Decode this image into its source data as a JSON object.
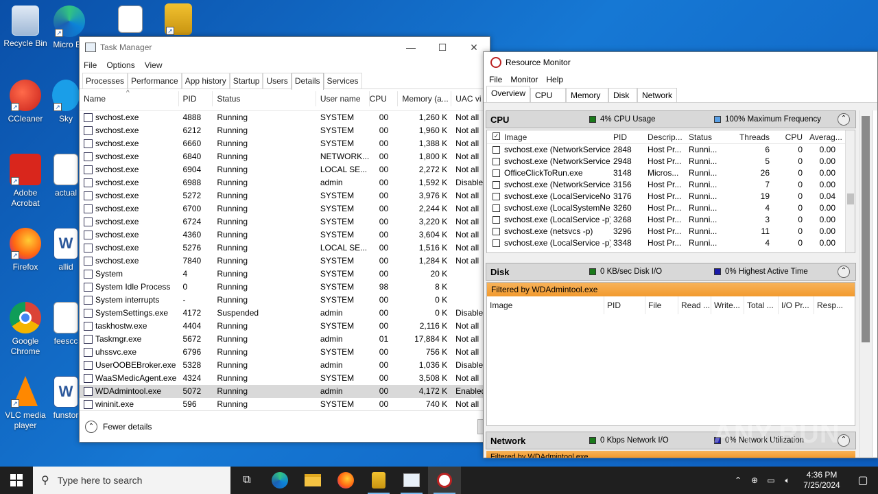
{
  "desktop": {
    "icons": [
      {
        "label": "Recycle Bin"
      },
      {
        "label": "Micro Ed"
      },
      {
        "label": "CCleaner"
      },
      {
        "label": "Sky"
      },
      {
        "label": "Adobe Acrobat"
      },
      {
        "label": "actual"
      },
      {
        "label": "Firefox"
      },
      {
        "label": "allid"
      },
      {
        "label": "Google Chrome"
      },
      {
        "label": "feescc"
      },
      {
        "label": "VLC media player"
      },
      {
        "label": "funstor"
      }
    ]
  },
  "taskmanager": {
    "title": "Task Manager",
    "controls": {
      "minimize": "—",
      "maximize": "☐",
      "close": "✕"
    },
    "menu": [
      "File",
      "Options",
      "View"
    ],
    "tabs": [
      "Processes",
      "Performance",
      "App history",
      "Startup",
      "Users",
      "Details",
      "Services"
    ],
    "active_tab": "Details",
    "columns": [
      "Name",
      "PID",
      "Status",
      "User name",
      "CPU",
      "Memory (a...",
      "UAC vi"
    ],
    "rows": [
      [
        "svchost.exe",
        "4888",
        "Running",
        "SYSTEM",
        "00",
        "1,260 K",
        "Not all"
      ],
      [
        "svchost.exe",
        "6212",
        "Running",
        "SYSTEM",
        "00",
        "1,960 K",
        "Not all"
      ],
      [
        "svchost.exe",
        "6660",
        "Running",
        "SYSTEM",
        "00",
        "1,388 K",
        "Not all"
      ],
      [
        "svchost.exe",
        "6840",
        "Running",
        "NETWORK...",
        "00",
        "1,800 K",
        "Not all"
      ],
      [
        "svchost.exe",
        "6904",
        "Running",
        "LOCAL SE...",
        "00",
        "2,272 K",
        "Not all"
      ],
      [
        "svchost.exe",
        "6988",
        "Running",
        "admin",
        "00",
        "1,592 K",
        "Disable"
      ],
      [
        "svchost.exe",
        "5272",
        "Running",
        "SYSTEM",
        "00",
        "3,976 K",
        "Not all"
      ],
      [
        "svchost.exe",
        "6700",
        "Running",
        "SYSTEM",
        "00",
        "2,244 K",
        "Not all"
      ],
      [
        "svchost.exe",
        "6724",
        "Running",
        "SYSTEM",
        "00",
        "3,220 K",
        "Not all"
      ],
      [
        "svchost.exe",
        "4360",
        "Running",
        "SYSTEM",
        "00",
        "3,604 K",
        "Not all"
      ],
      [
        "svchost.exe",
        "5276",
        "Running",
        "LOCAL SE...",
        "00",
        "1,516 K",
        "Not all"
      ],
      [
        "svchost.exe",
        "7840",
        "Running",
        "SYSTEM",
        "00",
        "1,284 K",
        "Not all"
      ],
      [
        "System",
        "4",
        "Running",
        "SYSTEM",
        "00",
        "20 K",
        ""
      ],
      [
        "System Idle Process",
        "0",
        "Running",
        "SYSTEM",
        "98",
        "8 K",
        ""
      ],
      [
        "System interrupts",
        "-",
        "Running",
        "SYSTEM",
        "00",
        "0 K",
        ""
      ],
      [
        "SystemSettings.exe",
        "4172",
        "Suspended",
        "admin",
        "00",
        "0 K",
        "Disable"
      ],
      [
        "taskhostw.exe",
        "4404",
        "Running",
        "SYSTEM",
        "00",
        "2,116 K",
        "Not all"
      ],
      [
        "Taskmgr.exe",
        "5672",
        "Running",
        "admin",
        "01",
        "17,884 K",
        "Not all"
      ],
      [
        "uhssvc.exe",
        "6796",
        "Running",
        "SYSTEM",
        "00",
        "756 K",
        "Not all"
      ],
      [
        "UserOOBEBroker.exe",
        "5328",
        "Running",
        "admin",
        "00",
        "1,036 K",
        "Disable"
      ],
      [
        "WaaSMedicAgent.exe",
        "4324",
        "Running",
        "SYSTEM",
        "00",
        "3,508 K",
        "Not all"
      ],
      [
        "WDAdmintool.exe",
        "5072",
        "Running",
        "admin",
        "00",
        "4,172 K",
        "Enabled"
      ],
      [
        "wininit.exe",
        "596",
        "Running",
        "SYSTEM",
        "00",
        "740 K",
        "Not all"
      ]
    ],
    "selected_row": "WDAdmintool.exe",
    "footer": "Fewer details"
  },
  "resmon": {
    "title": "Resource Monitor",
    "menu": [
      "File",
      "Monitor",
      "Help"
    ],
    "tabs": [
      "Overview",
      "CPU",
      "Memory",
      "Disk",
      "Network"
    ],
    "active_tab": "Overview",
    "cpu": {
      "label": "CPU",
      "usage": "4% CPU Usage",
      "freq": "100% Maximum Frequency",
      "usage_color": "#1a7a1a",
      "freq_color": "#5aa0e6",
      "columns": [
        "Image",
        "PID",
        "Descrip...",
        "Status",
        "Threads",
        "CPU",
        "Averag..."
      ],
      "rows": [
        [
          "svchost.exe (NetworkService...",
          "2848",
          "Host Pr...",
          "Runni...",
          "6",
          "0",
          "0.00"
        ],
        [
          "svchost.exe (NetworkService...",
          "2948",
          "Host Pr...",
          "Runni...",
          "5",
          "0",
          "0.00"
        ],
        [
          "OfficeClickToRun.exe",
          "3148",
          "Micros...",
          "Runni...",
          "26",
          "0",
          "0.00"
        ],
        [
          "svchost.exe (NetworkService...",
          "3156",
          "Host Pr...",
          "Runni...",
          "7",
          "0",
          "0.00"
        ],
        [
          "svchost.exe (LocalServiceNo...",
          "3176",
          "Host Pr...",
          "Runni...",
          "19",
          "0",
          "0.04"
        ],
        [
          "svchost.exe (LocalSystemNet...",
          "3260",
          "Host Pr...",
          "Runni...",
          "4",
          "0",
          "0.00"
        ],
        [
          "svchost.exe (LocalService -p)",
          "3268",
          "Host Pr...",
          "Runni...",
          "3",
          "0",
          "0.00"
        ],
        [
          "svchost.exe (netsvcs -p)",
          "3296",
          "Host Pr...",
          "Runni...",
          "11",
          "0",
          "0.00"
        ],
        [
          "svchost.exe (LocalService -p)",
          "3348",
          "Host Pr...",
          "Runni...",
          "4",
          "0",
          "0.00"
        ]
      ]
    },
    "disk": {
      "label": "Disk",
      "io": "0 KB/sec Disk I/O",
      "active": "0% Highest Active Time",
      "io_color": "#1a7a1a",
      "active_color": "#1a1aa8",
      "filter": "Filtered by WDAdmintool.exe",
      "columns": [
        "Image",
        "PID",
        "File",
        "Read ...",
        "Write...",
        "Total ...",
        "I/O Pr...",
        "Resp..."
      ]
    },
    "network": {
      "label": "Network",
      "io": "0 Kbps Network I/O",
      "util": "0% Network Utilization",
      "filter": "Filtered by WDAdmintool.exe"
    }
  },
  "taskbar": {
    "search_placeholder": "Type here to search",
    "time": "4:36 PM",
    "date": "7/25/2024"
  },
  "watermark": "ANY.RUN"
}
